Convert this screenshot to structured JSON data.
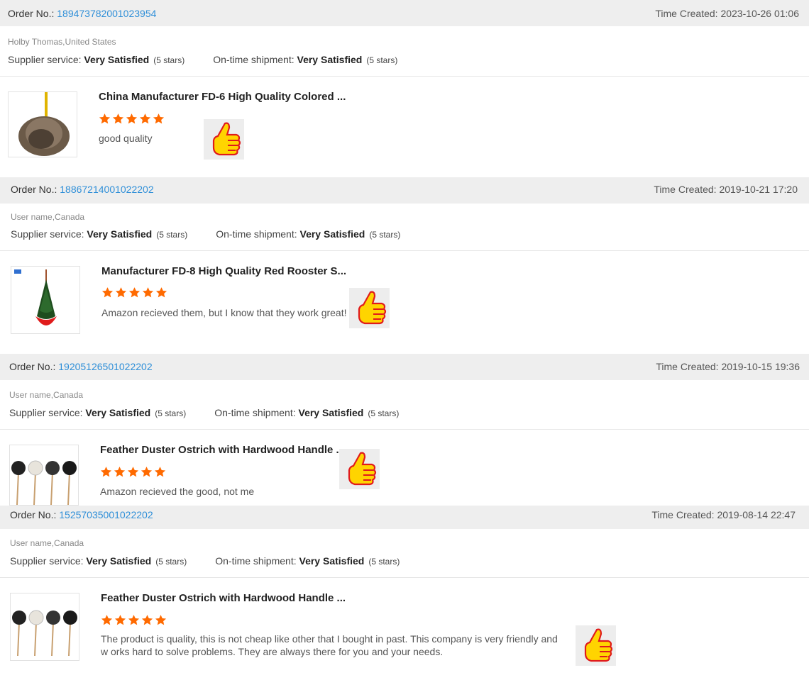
{
  "labels": {
    "order_no": "Order No.:",
    "time_created": "Time Created:",
    "supplier_service": "Supplier service:",
    "ontime_shipment": "On-time shipment:",
    "very_satisfied": "Very Satisfied",
    "five_stars": "(5 stars)"
  },
  "colors": {
    "star": "#ff6a00",
    "link": "#2f8fd8",
    "bar": "#eeeeee"
  },
  "icons": {
    "star": "star-icon",
    "thumb": "thumbs-up-icon"
  },
  "reviews": [
    {
      "order_no": "189473782001023954",
      "time": "2023-10-26 01:06",
      "user": "Holby Thomas,United States",
      "product": "China Manufacturer FD-6 High Quality Colored ...",
      "rating": 5,
      "comment": "good quality"
    },
    {
      "order_no": "18867214001022202",
      "time": "2019-10-21 17:20",
      "user": "User name,Canada",
      "product": "Manufacturer FD-8 High Quality Red Rooster S...",
      "rating": 5,
      "comment": "Amazon recieved them, but I know that they work great!"
    },
    {
      "order_no": "19205126501022202",
      "time": "2019-10-15 19:36",
      "user": "User name,Canada",
      "product": "Feather Duster Ostrich with Hardwood Handle ...",
      "rating": 5,
      "comment": "Amazon recieved the good, not me"
    },
    {
      "order_no": "15257035001022202",
      "time": "2019-08-14 22:47",
      "user": "User name,Canada",
      "product": "Feather Duster Ostrich with Hardwood Handle ...",
      "rating": 5,
      "comment": "The product is quality, this is not cheap like other that I bought in past. This company is very friendly and w orks hard to solve problems. They are always there for you and your needs."
    }
  ]
}
